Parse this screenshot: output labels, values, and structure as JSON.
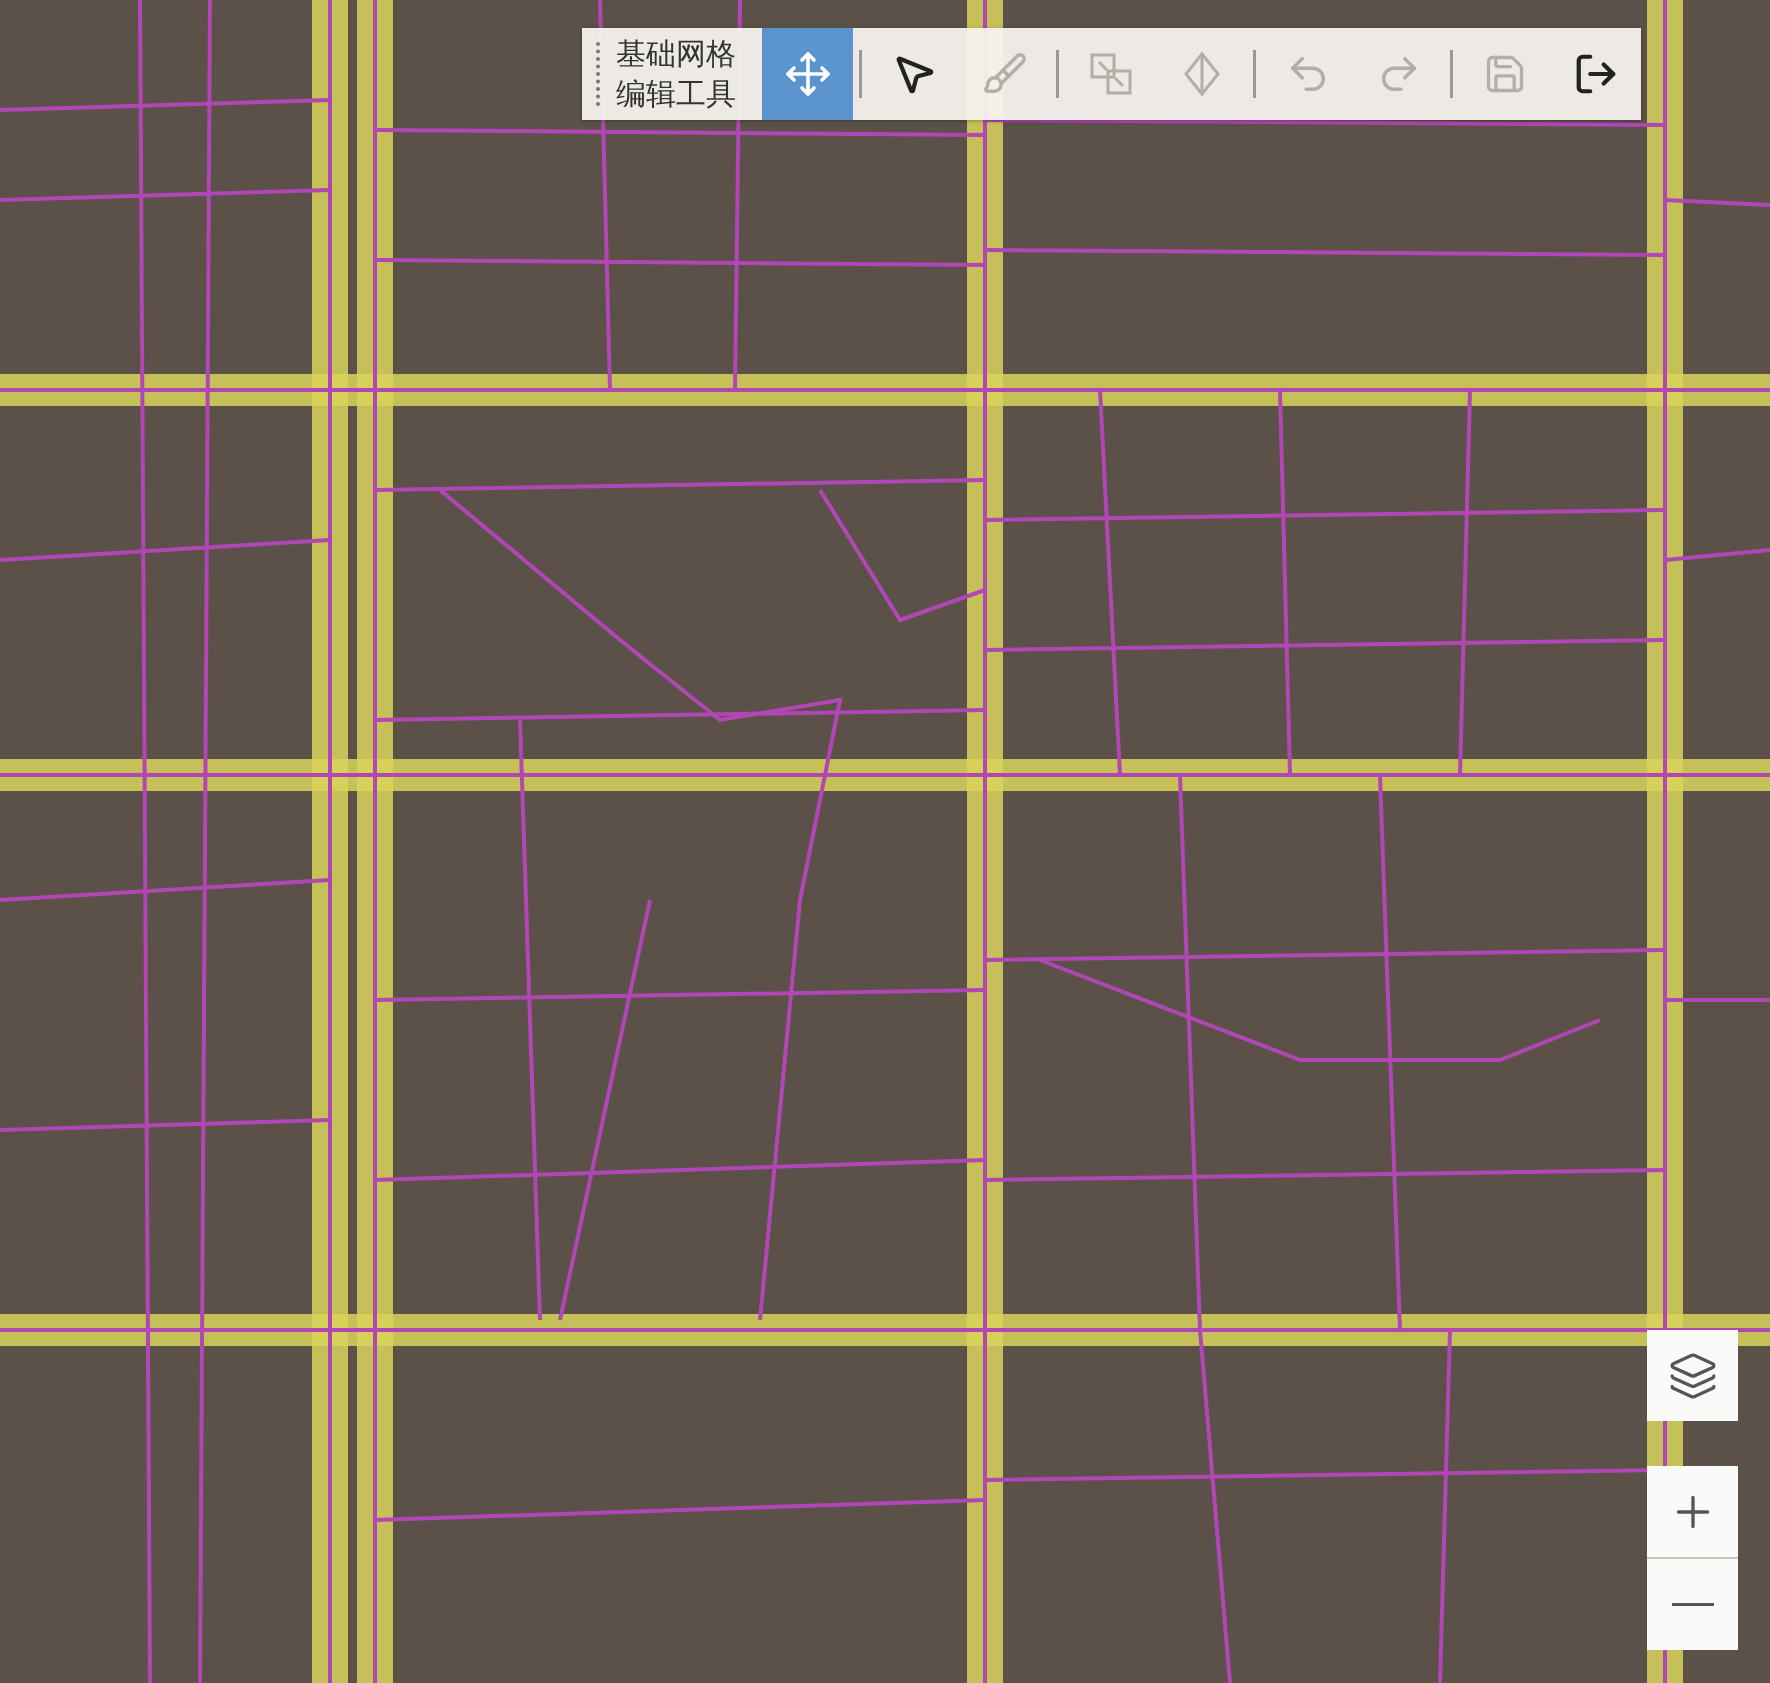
{
  "toolbar": {
    "title": "基础网格编辑工具",
    "tools": [
      {
        "kind": "move",
        "selected": true,
        "disabled": false
      },
      {
        "kind": "separator"
      },
      {
        "kind": "pointer",
        "selected": false,
        "disabled": false
      },
      {
        "kind": "brush",
        "selected": false,
        "disabled": true
      },
      {
        "kind": "separator"
      },
      {
        "kind": "split",
        "selected": false,
        "disabled": true
      },
      {
        "kind": "cut",
        "selected": false,
        "disabled": true
      },
      {
        "kind": "separator"
      },
      {
        "kind": "undo",
        "selected": false,
        "disabled": true
      },
      {
        "kind": "redo",
        "selected": false,
        "disabled": true
      },
      {
        "kind": "separator"
      },
      {
        "kind": "save",
        "selected": false,
        "disabled": true
      },
      {
        "kind": "exit",
        "selected": false,
        "disabled": false
      }
    ]
  },
  "map_controls": [
    {
      "kind": "layers"
    },
    {
      "kind": "zoom-in"
    },
    {
      "kind": "zoom-out"
    }
  ]
}
